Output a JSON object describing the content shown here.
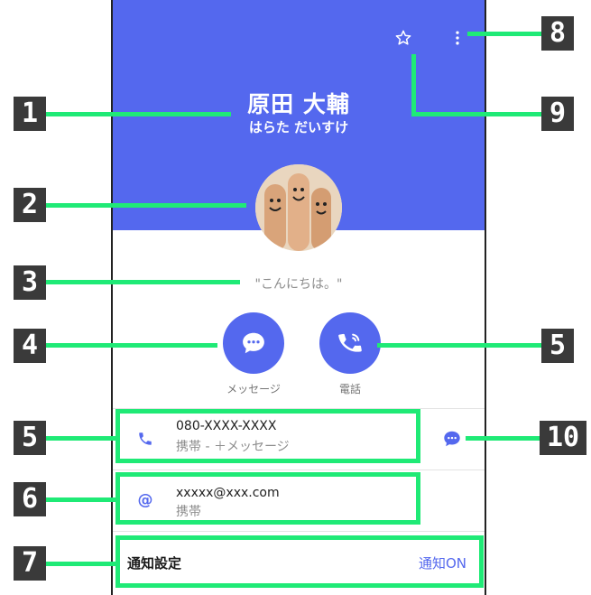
{
  "colors": {
    "accent": "#5468EE",
    "callout": "#1FEA76",
    "badge": "#3A3A3A"
  },
  "contact": {
    "name": "原田 大輔",
    "kana": "はらた だいすけ",
    "status": "\"こんにちは。\""
  },
  "actions": {
    "message_label": "メッセージ",
    "call_label": "電話"
  },
  "phone": {
    "number": "080-XXXX-XXXX",
    "type": "携帯 - ＋メッセージ"
  },
  "email": {
    "address": "xxxxx@xxx.com",
    "type": "携帯"
  },
  "notification": {
    "label": "通知設定",
    "value": "通知ON"
  },
  "icons": [
    "star-outline-icon",
    "more-vert-icon",
    "chat-bubble-icon",
    "phone-ringing-icon",
    "phone-icon",
    "message-icon",
    "at-sign-icon"
  ],
  "callouts": {
    "c1": "1",
    "c2": "2",
    "c3": "3",
    "c4": "4",
    "c5a": "5",
    "c5b": "5",
    "c6": "6",
    "c7": "7",
    "c8": "8",
    "c9": "9",
    "c10": "10"
  }
}
